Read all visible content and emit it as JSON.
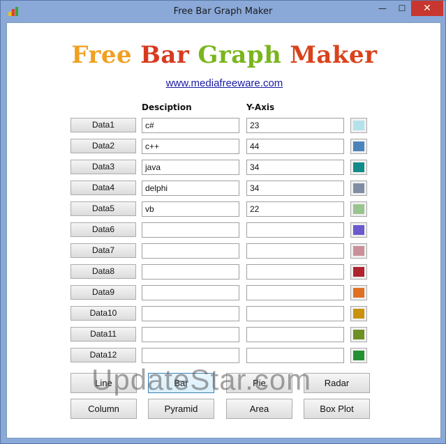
{
  "window": {
    "title": "Free Bar Graph Maker",
    "min_glyph": "—",
    "max_glyph": "☐",
    "close_glyph": "✕"
  },
  "logo": {
    "word1": "Free",
    "word2": "Bar",
    "word3": "Graph",
    "word4": "Maker"
  },
  "link": "www.mediafreeware.com",
  "headers": {
    "description": "Desciption",
    "y_axis": "Y-Axis"
  },
  "rows": [
    {
      "label": "Data1",
      "desc": "c#",
      "y": "23",
      "color": "#b4e2ec"
    },
    {
      "label": "Data2",
      "desc": "c++",
      "y": "44",
      "color": "#4a84bd"
    },
    {
      "label": "Data3",
      "desc": "java",
      "y": "34",
      "color": "#128c89"
    },
    {
      "label": "Data4",
      "desc": "delphi",
      "y": "34",
      "color": "#7f8ea3"
    },
    {
      "label": "Data5",
      "desc": "vb",
      "y": "22",
      "color": "#98c48e"
    },
    {
      "label": "Data6",
      "desc": "",
      "y": "",
      "color": "#6a5acd"
    },
    {
      "label": "Data7",
      "desc": "",
      "y": "",
      "color": "#c9909a"
    },
    {
      "label": "Data8",
      "desc": "",
      "y": "",
      "color": "#b0232d"
    },
    {
      "label": "Data9",
      "desc": "",
      "y": "",
      "color": "#e07022"
    },
    {
      "label": "Data10",
      "desc": "",
      "y": "",
      "color": "#c8920f"
    },
    {
      "label": "Data11",
      "desc": "",
      "y": "",
      "color": "#6e8f22"
    },
    {
      "label": "Data12",
      "desc": "",
      "y": "",
      "color": "#239032"
    }
  ],
  "chart_buttons": {
    "line": "Line",
    "bar": "Bar",
    "pie": "Pie",
    "radar": "Radar",
    "column": "Column",
    "pyramid": "Pyramid",
    "area": "Area",
    "box_plot": "Box Plot"
  },
  "watermark": "UpdateStar.com"
}
